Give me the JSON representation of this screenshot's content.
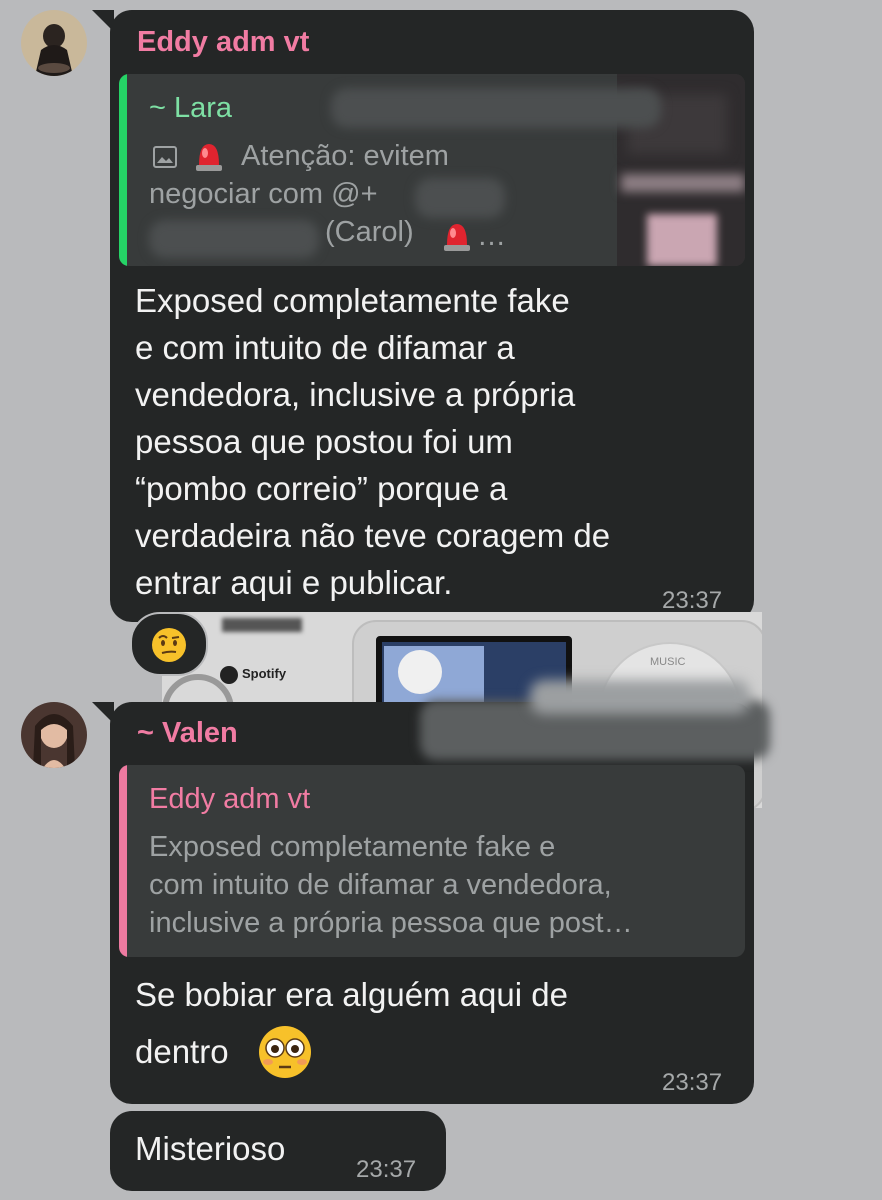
{
  "msg1": {
    "sender": "Eddy adm vt",
    "quote": {
      "author": "~ Lara",
      "icon": "image-icon",
      "lines": [
        "Atenção: evitem",
        "negociar com @+",
        "(Carol)"
      ],
      "emoji": "rotating-light-emoji"
    },
    "text_lines": [
      "Exposed completamente fake",
      "e com intuito de difamar a",
      "vendedora, inclusive a própria",
      "pessoa que postou foi um",
      "“pombo correio” porque a",
      "verdadeira não teve coragem de",
      "entrar aqui e publicar."
    ],
    "time": "23:37",
    "reaction": "face-with-raised-eyebrow-emoji"
  },
  "background_sticker": {
    "brand": "Spotify",
    "label": "MUSIC"
  },
  "msg2": {
    "sender": "~ Valen",
    "quote": {
      "author": "Eddy adm vt",
      "lines": [
        "Exposed completamente fake e",
        "com intuito de difamar a vendedora,",
        "inclusive a própria pessoa que post…"
      ]
    },
    "text_lines": [
      "Se bobiar era alguém aqui de",
      "dentro"
    ],
    "emoji": "flushed-face-emoji",
    "time": "23:37"
  },
  "msg3": {
    "text": "Misterioso",
    "time": "23:37"
  },
  "colors": {
    "background": "#b9babc",
    "bubble": "#242626",
    "quote_bg": "#383b3b",
    "sender_pink": "#f17ca3",
    "lara_green": "#7ee0a4",
    "accent_green": "#25d366",
    "accent_pink": "#ee7aa0"
  }
}
